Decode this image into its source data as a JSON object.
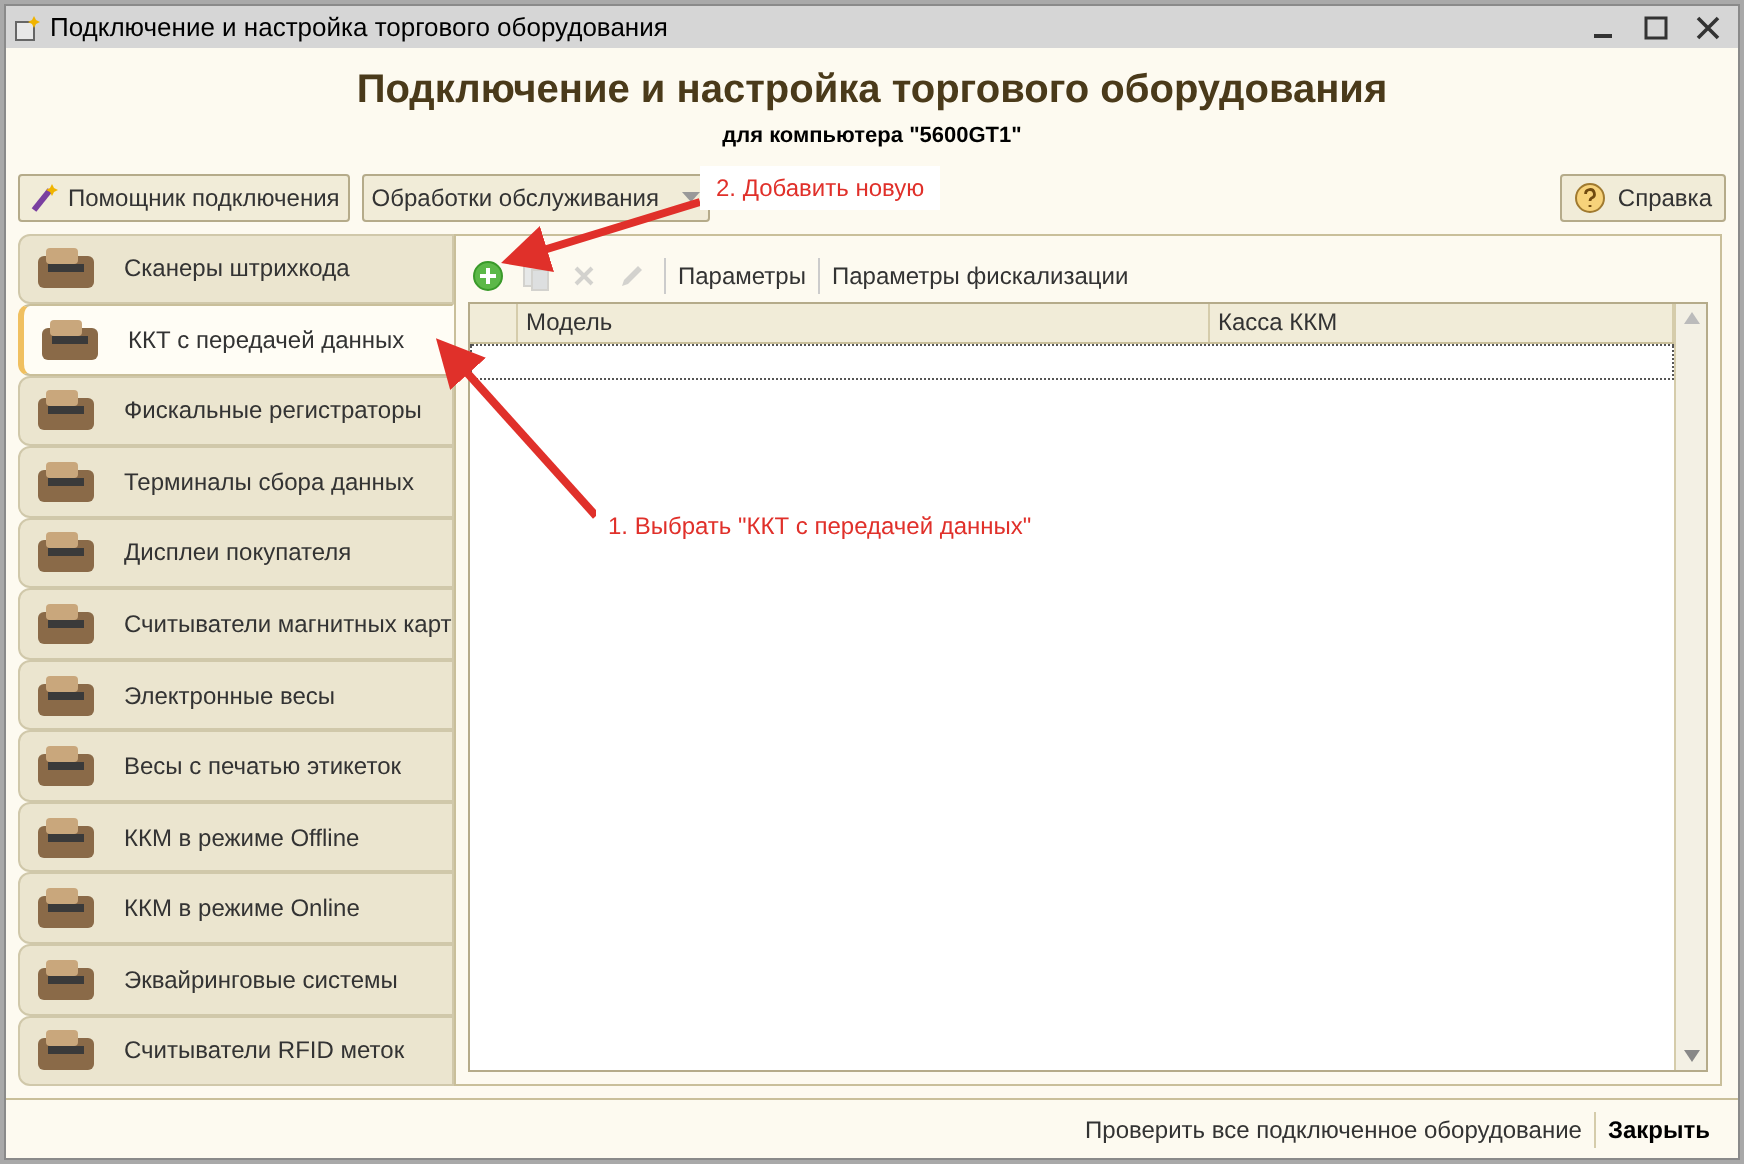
{
  "window": {
    "title": "Подключение и настройка торгового оборудования"
  },
  "header": {
    "title": "Подключение и настройка торгового оборудования",
    "subtitle": "для компьютера \"5600GT1\""
  },
  "top_buttons": [
    {
      "label": "Помощник подключения",
      "kind": "wizard"
    },
    {
      "label": "Обработки обслуживания",
      "kind": "dropdown"
    }
  ],
  "help_button": {
    "label": "Справка"
  },
  "sidebar": {
    "items": [
      {
        "label": "Сканеры штрихкода",
        "selected": false
      },
      {
        "label": "ККТ с передачей данных",
        "selected": true
      },
      {
        "label": "Фискальные регистраторы",
        "selected": false
      },
      {
        "label": "Терминалы сбора данных",
        "selected": false
      },
      {
        "label": "Дисплеи покупателя",
        "selected": false
      },
      {
        "label": "Считыватели магнитных карт",
        "selected": false
      },
      {
        "label": "Электронные весы",
        "selected": false
      },
      {
        "label": "Весы с печатью этикеток",
        "selected": false
      },
      {
        "label": "ККМ в режиме Offline",
        "selected": false
      },
      {
        "label": "ККМ в режиме Online",
        "selected": false
      },
      {
        "label": "Эквайринговые системы",
        "selected": false
      },
      {
        "label": "Считыватели RFID меток",
        "selected": false
      }
    ]
  },
  "toolbar": {
    "icon_buttons": [
      {
        "kind": "add",
        "disabled": false
      },
      {
        "kind": "copy",
        "disabled": true
      },
      {
        "kind": "delete",
        "disabled": true
      },
      {
        "kind": "edit",
        "disabled": true
      }
    ],
    "text_buttons": [
      "Параметры",
      "Параметры фискализации"
    ]
  },
  "table": {
    "columns": [
      "Модель",
      "Касса ККМ"
    ]
  },
  "annotations": [
    {
      "text": "2. Добавить новую"
    },
    {
      "text": "1. Выбрать \"ККТ с передачей данных\""
    }
  ],
  "footer": {
    "buttons": [
      {
        "label": "Проверить все подключенное оборудование",
        "bold": false
      },
      {
        "label": "Закрыть",
        "bold": true
      }
    ]
  }
}
